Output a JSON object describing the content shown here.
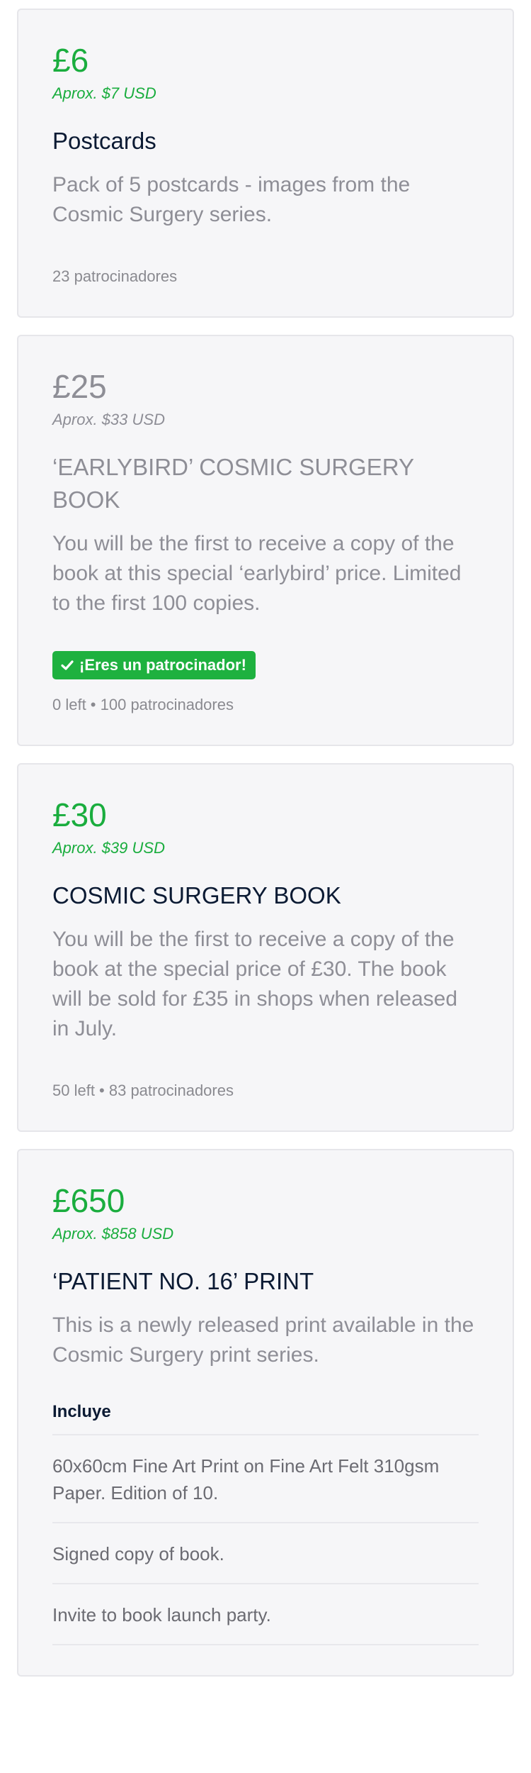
{
  "rewards": [
    {
      "price": "£6",
      "approx": "Aprox. $7 USD",
      "title": "Postcards",
      "description": "Pack of 5 postcards - images from the Cosmic Surgery series.",
      "meta": "23 patrocinadores"
    },
    {
      "price": "£25",
      "approx": "Aprox. $33 USD",
      "title": "‘EARLYBIRD’ COSMIC SURGERY BOOK",
      "description": "You will be the first to receive a copy of the book at this special ‘earlybird’ price. Limited to the first 100 copies.",
      "badge": "¡Eres un patrocinador!",
      "meta": "0 left • 100 patrocinadores"
    },
    {
      "price": "£30",
      "approx": "Aprox. $39 USD",
      "title": "COSMIC SURGERY BOOK",
      "description": "You will be the first to receive a copy of the book at the special price of £30. The book will be sold for £35 in shops when released in July.",
      "meta": "50 left • 83 patrocinadores"
    },
    {
      "price": "£650",
      "approx": "Aprox. $858 USD",
      "title": "‘PATIENT NO. 16’ PRINT",
      "description": "This is a newly released print available in the Cosmic Surgery print series.",
      "includes_heading": "Incluye",
      "includes": [
        "60x60cm Fine Art Print on Fine Art Felt 310gsm Paper. Edition of 10.",
        "Signed copy of book.",
        "Invite to book launch party."
      ]
    }
  ],
  "colors": {
    "accent_green": "#1aad3e",
    "badge_green": "#1eb13f",
    "title_navy": "#0b1a33",
    "muted_gray": "#8e8e96",
    "card_background": "#f6f6f8"
  },
  "icons": {
    "badge": "check-icon"
  }
}
